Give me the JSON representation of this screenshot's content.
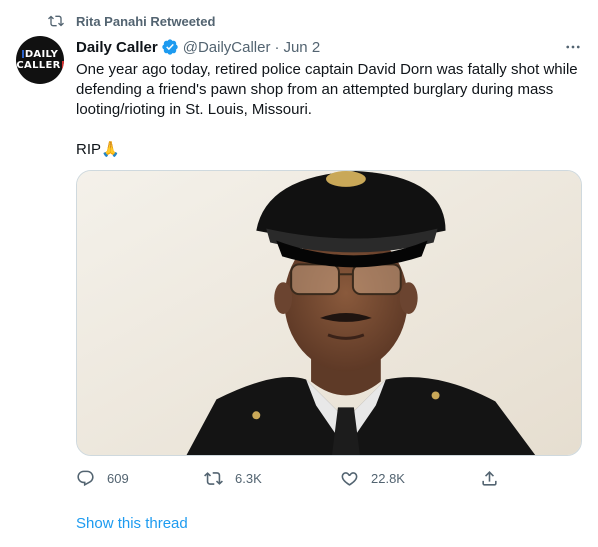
{
  "retweet": {
    "label": "Rita Panahi Retweeted",
    "icon": "retweet-icon"
  },
  "tweet": {
    "author": {
      "name": "Daily Caller",
      "handle": "@DailyCaller",
      "separator": "·",
      "date": "Jun 2",
      "avatar_text": [
        "DAILY",
        "CALLER"
      ],
      "verified_color": "#1d9bf0"
    },
    "paragraphs": [
      "One year ago today, retired police captain David Dorn was fatally shot while defending a friend's pawn shop from an attempted burglary during mass looting/rioting in St. Louis, Missouri.",
      "RIP"
    ],
    "emoji": "🙏",
    "media": {
      "description_icon": "photo-portrait"
    },
    "actions": {
      "reply": {
        "icon": "reply-icon",
        "count": "609"
      },
      "retweet": {
        "icon": "retweet-icon",
        "count": "6.3K"
      },
      "like": {
        "icon": "heart-icon",
        "count": "22.8K"
      },
      "share": {
        "icon": "share-icon"
      }
    }
  },
  "thread_link": "Show this thread",
  "colors": {
    "accent": "#1d9bf0",
    "muted": "#536471",
    "text": "#0f1419",
    "border": "#cfd9de"
  }
}
